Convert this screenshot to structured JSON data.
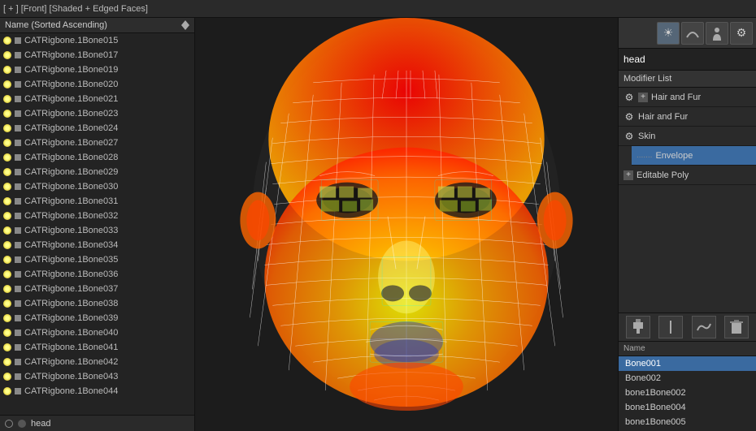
{
  "topbar": {
    "label": "[ + ] [Front] [Shaded + Edged Faces]"
  },
  "list_header": {
    "label": "Name (Sorted Ascending)"
  },
  "scene_items": [
    "CATRigbone.1Bone015",
    "CATRigbone.1Bone017",
    "CATRigbone.1Bone019",
    "CATRigbone.1Bone020",
    "CATRigbone.1Bone021",
    "CATRigbone.1Bone023",
    "CATRigbone.1Bone024",
    "CATRigbone.1Bone027",
    "CATRigbone.1Bone028",
    "CATRigbone.1Bone029",
    "CATRigbone.1Bone030",
    "CATRigbone.1Bone031",
    "CATRigbone.1Bone032",
    "CATRigbone.1Bone033",
    "CATRigbone.1Bone034",
    "CATRigbone.1Bone035",
    "CATRigbone.1Bone036",
    "CATRigbone.1Bone037",
    "CATRigbone.1Bone038",
    "CATRigbone.1Bone039",
    "CATRigbone.1Bone040",
    "CATRigbone.1Bone041",
    "CATRigbone.1Bone042",
    "CATRigbone.1Bone043",
    "CATRigbone.1Bone044"
  ],
  "status": {
    "label": "head"
  },
  "right_panel": {
    "object_name": "head",
    "modifier_list_label": "Modifier List",
    "modifiers": [
      {
        "id": "hair-fur-1",
        "label": "Hair and Fur",
        "has_gear": true,
        "has_plus": true,
        "indent": false,
        "selected": false
      },
      {
        "id": "hair-fur-2",
        "label": "Hair and Fur",
        "has_gear": true,
        "has_plus": false,
        "indent": false,
        "selected": false
      },
      {
        "id": "skin",
        "label": "Skin",
        "has_gear": true,
        "has_plus": false,
        "indent": false,
        "selected": false
      },
      {
        "id": "envelope",
        "label": "Envelope",
        "has_gear": false,
        "has_plus": false,
        "indent": true,
        "selected": true
      },
      {
        "id": "editable-poly",
        "label": "Editable Poly",
        "has_gear": false,
        "has_plus": true,
        "indent": false,
        "selected": false
      }
    ],
    "bone_header": "Name",
    "bones": [
      {
        "label": "Bone001",
        "selected": true
      },
      {
        "label": "Bone002",
        "selected": false
      },
      {
        "label": "bone1Bone002",
        "selected": false
      },
      {
        "label": "bone1Bone004",
        "selected": false
      },
      {
        "label": "bone1Bone005",
        "selected": false
      }
    ]
  }
}
